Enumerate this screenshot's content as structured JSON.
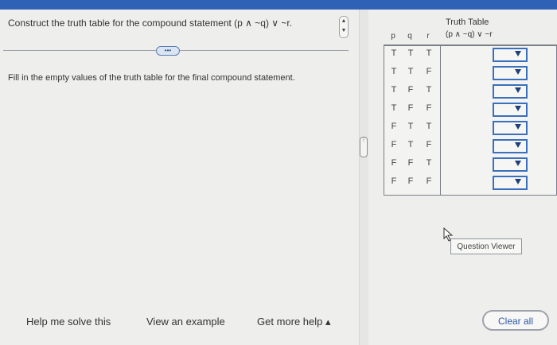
{
  "question": {
    "text": "Construct the truth table for the compound statement (p ∧ ~q) ∨ ~r.",
    "more_button": "•••",
    "instruction": "Fill in the empty values of the truth table for the final compound statement."
  },
  "truth_table": {
    "title": "Truth Table",
    "header_expression": "(p ∧ ~q)  ∨  ~r",
    "columns": [
      "p",
      "q",
      "r"
    ],
    "rows": [
      {
        "p": "T",
        "q": "T",
        "r": "T"
      },
      {
        "p": "T",
        "q": "T",
        "r": "F"
      },
      {
        "p": "T",
        "q": "F",
        "r": "T"
      },
      {
        "p": "T",
        "q": "F",
        "r": "F"
      },
      {
        "p": "F",
        "q": "T",
        "r": "T"
      },
      {
        "p": "F",
        "q": "T",
        "r": "F"
      },
      {
        "p": "F",
        "q": "F",
        "r": "T"
      },
      {
        "p": "F",
        "q": "F",
        "r": "F"
      }
    ],
    "dropdown_selected": [
      "",
      "",
      "",
      "",
      "",
      "",
      "",
      ""
    ]
  },
  "question_viewer_label": "Question Viewer",
  "footer": {
    "help_me_solve": "Help me solve this",
    "view_example": "View an example",
    "get_more_help": "Get more help ▴",
    "clear_all": "Clear all"
  },
  "icons": {
    "collapse": "collapse-arrows-icon",
    "grip": "vertical-grip-icon",
    "dropdown": "chevron-down-icon",
    "cursor": "pointer-cursor-icon"
  },
  "colors": {
    "accent": "#2f62b6",
    "dropdown_border": "#3a6fbe"
  }
}
